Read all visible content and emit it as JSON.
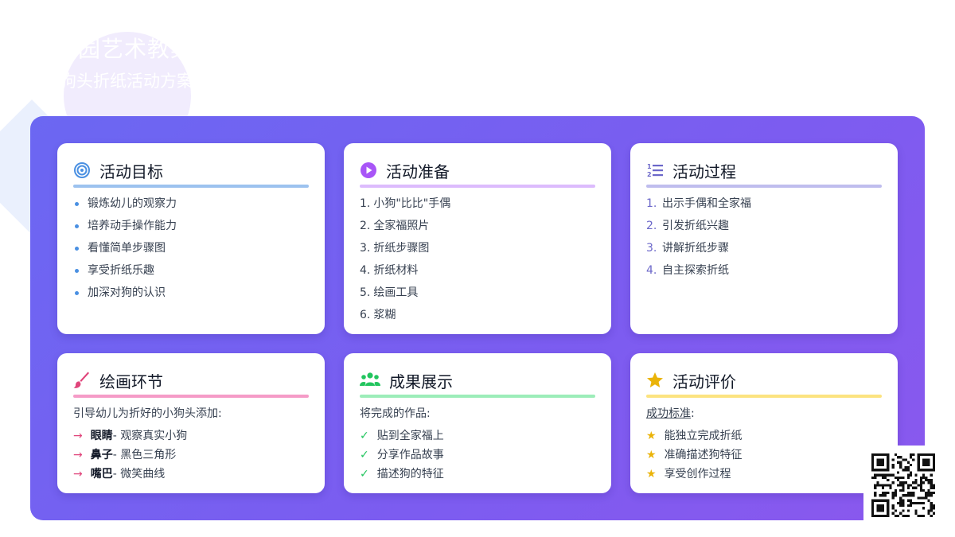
{
  "header": {
    "title": "幼儿园艺术教案设计",
    "subtitle": "小狗头折纸活动方案"
  },
  "colors": {
    "panel_start": "#6b67f2",
    "panel_end": "#8a58ee",
    "goal": "#4a90e2",
    "prep": "#a855f7",
    "process": "#6b67c9",
    "drawing": "#e0457b",
    "results": "#22c55e",
    "evaluation": "#eab308"
  },
  "cards": {
    "goals": {
      "icon": "target-icon",
      "title": "活动目标",
      "items": [
        "锻炼幼儿的观察力",
        "培养动手操作能力",
        "看懂简单步骤图",
        "享受折纸乐趣",
        "加深对狗的认识"
      ]
    },
    "preparation": {
      "icon": "play-circle-icon",
      "title": "活动准备",
      "items": [
        {
          "num": "1.",
          "text": "小狗\"比比\"手偶"
        },
        {
          "num": "2.",
          "text": "全家福照片"
        },
        {
          "num": "3.",
          "text": "折纸步骤图"
        },
        {
          "num": "4.",
          "text": "折纸材料"
        },
        {
          "num": "5.",
          "text": "绘画工具"
        },
        {
          "num": "6.",
          "text": "浆糊"
        }
      ]
    },
    "process": {
      "icon": "numbered-list-icon",
      "title": "活动过程",
      "items": [
        {
          "num": "1.",
          "text": "出示手偶和全家福"
        },
        {
          "num": "2.",
          "text": "引发折纸兴趣"
        },
        {
          "num": "3.",
          "text": "讲解折纸步骤"
        },
        {
          "num": "4.",
          "text": "自主探索折纸"
        }
      ]
    },
    "drawing": {
      "icon": "paintbrush-icon",
      "title": "绘画环节",
      "intro": "引导幼儿为折好的小狗头添加:",
      "items": [
        {
          "bold": "眼睛",
          "text": " - 观察真实小狗"
        },
        {
          "bold": "鼻子",
          "text": " - 黑色三角形"
        },
        {
          "bold": "嘴巴",
          "text": " - 微笑曲线"
        }
      ]
    },
    "results": {
      "icon": "users-icon",
      "title": "成果展示",
      "intro": "将完成的作品:",
      "items": [
        "贴到全家福上",
        "分享作品故事",
        "描述狗的特征"
      ]
    },
    "evaluation": {
      "icon": "star-icon",
      "title": "活动评价",
      "intro_link": "成功标准",
      "intro_suffix": ":",
      "items": [
        "能独立完成折纸",
        "准确描述狗特征",
        "享受创作过程"
      ]
    }
  },
  "qr": {
    "icon": "qr-code-icon"
  }
}
